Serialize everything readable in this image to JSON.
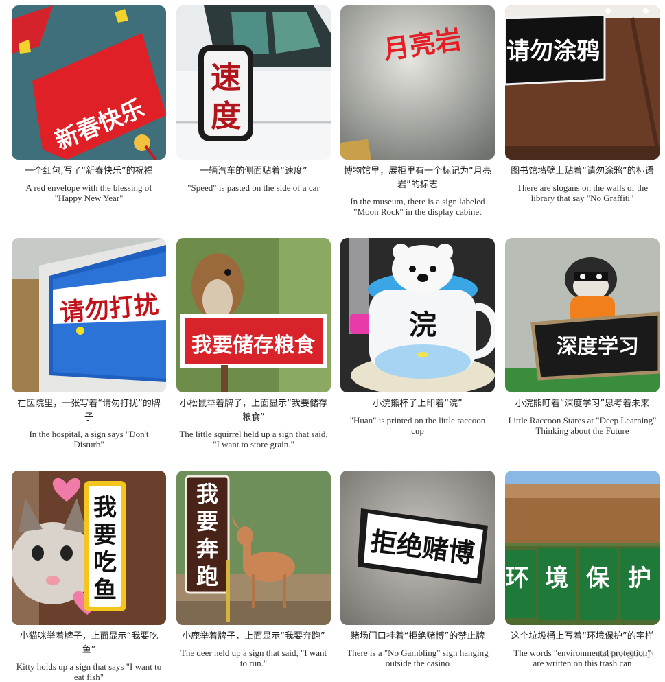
{
  "items": [
    {
      "sign": "新春快乐",
      "zh": "一个红包,写了“新春快乐”的祝福",
      "en": "A red envelope with the blessing of \"Happy New Year\"",
      "icon": "red-envelope"
    },
    {
      "sign": "速度",
      "zh": "一辆汽车的侧面贴着“速度”",
      "en": "\"Speed\" is pasted on the side of a car",
      "icon": "car"
    },
    {
      "sign": "月亮岩",
      "zh": "博物馆里，展柜里有一个标记为“月亮岩”的标志",
      "en": "In the museum, there is a sign labeled \"Moon Rock\" in the display cabinet",
      "icon": "museum-wall"
    },
    {
      "sign": "请勿涂鸦",
      "zh": "图书馆墙壁上贴着“请勿涂鸦”的标语",
      "en": "There are slogans on the walls of the library that say \"No Graffiti\"",
      "icon": "library-wall"
    },
    {
      "sign": "请勿打扰",
      "zh": "在医院里，一张写着“请勿打扰”的牌子",
      "en": "In the hospital, a sign says \"Don't Disturb\"",
      "icon": "hospital-sign"
    },
    {
      "sign": "我要储存粮食",
      "zh": "小松鼠举着牌子，上面显示“我要储存粮食”",
      "en": "The little squirrel held up a sign that said, \"I want to store grain.\"",
      "icon": "squirrel"
    },
    {
      "sign": "浣",
      "zh": "小浣熊杯子上印着“浣”",
      "en": "\"Huan\" is printed on the little raccoon cup",
      "icon": "raccoon-cup"
    },
    {
      "sign": "深度学习",
      "zh": "小浣熊盯着“深度学习”思考着未来",
      "en": "Little Raccoon Stares at \"Deep Learning\" Thinking about the Future",
      "icon": "raccoon"
    },
    {
      "sign": "我要吃鱼",
      "zh": "小猫咪举着牌子，上面显示“我要吃鱼”",
      "en": "Kitty holds up a sign that says \"I want to eat fish\"",
      "icon": "kitten"
    },
    {
      "sign": "我要奔跑",
      "zh": "小鹿举着牌子，上面显示“我要奔跑”",
      "en": "The deer held up a sign that said, \"I want to run.\"",
      "icon": "deer"
    },
    {
      "sign": "拒绝赌博",
      "zh": "赌场门口挂着“拒绝赌博”的禁止牌",
      "en": "There is a \"No Gambling\" sign hanging outside the casino",
      "icon": "casino-sign"
    },
    {
      "sign": "环境保护",
      "zh": "这个垃圾桶上写着“环境保护”的字样",
      "en": "The words \"environmental protection\" are written on this trash can",
      "icon": "trash-bins"
    }
  ],
  "watermark": "CSDN @AI小"
}
